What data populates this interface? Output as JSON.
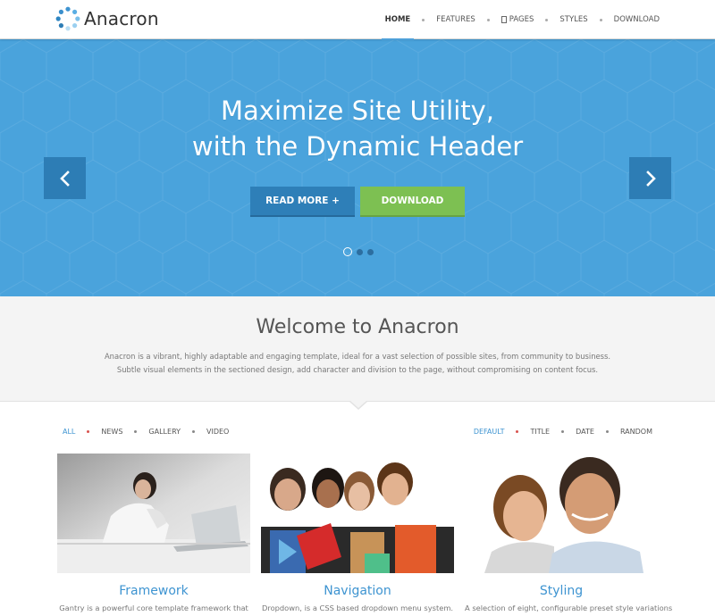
{
  "brand": {
    "name": "Anacron",
    "accent": "#4ea0d9"
  },
  "nav": {
    "items": [
      {
        "label": "HOME",
        "active": true
      },
      {
        "label": "FEATURES",
        "active": false
      },
      {
        "label": "PAGES",
        "active": false,
        "icon": "page-icon"
      },
      {
        "label": "STYLES",
        "active": false
      },
      {
        "label": "DOWNLOAD",
        "active": false
      }
    ]
  },
  "hero": {
    "title_line1": "Maximize Site Utility,",
    "title_line2": "with the Dynamic Header",
    "read_more_label": "READ MORE +",
    "download_label": "DOWNLOAD",
    "background": "#4aa3dc",
    "slides_total": 3,
    "slide_active": 1,
    "prev_icon": "chevron-left-icon",
    "next_icon": "chevron-right-icon"
  },
  "welcome": {
    "title": "Welcome to Anacron",
    "text": "Anacron is a vibrant, highly adaptable and engaging template, ideal for a vast selection of possible sites, from community to business. Subtle visual elements in the sectioned design, add character and division to the page, without compromising on content focus."
  },
  "filters": {
    "categories": [
      "ALL",
      "NEWS",
      "GALLERY",
      "VIDEO"
    ],
    "categories_active": "ALL",
    "sorts": [
      "DEFAULT",
      "TITLE",
      "DATE",
      "RANDOM"
    ],
    "sorts_active": "DEFAULT"
  },
  "cards": [
    {
      "title": "Framework",
      "text": "Gantry is a powerful core template framework that"
    },
    {
      "title": "Navigation",
      "text": "Dropdown, is a CSS based dropdown menu system."
    },
    {
      "title": "Styling",
      "text": "A selection of eight, configurable preset style variations"
    }
  ]
}
